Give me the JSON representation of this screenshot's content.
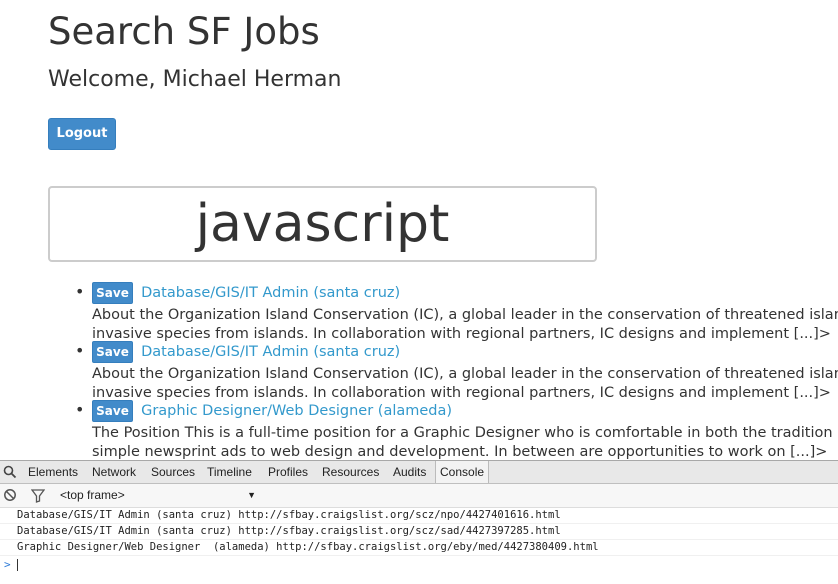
{
  "header": {
    "title": "Search SF Jobs",
    "welcome": "Welcome, Michael Herman",
    "logout_label": "Logout"
  },
  "search": {
    "value": "javascript"
  },
  "jobs": [
    {
      "save_label": "Save",
      "title": "Database/GIS/IT Admin (santa cruz)",
      "line1": "About the Organization Island Conservation (IC), a global leader in the conservation of threatened islan",
      "line2": "invasive species from islands. In collaboration with regional partners, IC designs and implement [...]>"
    },
    {
      "save_label": "Save",
      "title": "Database/GIS/IT Admin (santa cruz)",
      "line1": "About the Organization Island Conservation (IC), a global leader in the conservation of threatened islan",
      "line2": "invasive species from islands. In collaboration with regional partners, IC designs and implement [...]>"
    },
    {
      "save_label": "Save",
      "title": "Graphic Designer/Web Designer (alameda)",
      "line1": "The Position This is a full-time position for a Graphic Designer who is comfortable in both the tradition",
      "line2": "simple newsprint ads to web design and development. In between are opportunities to work on [...]>"
    }
  ],
  "devtools": {
    "tabs": [
      "Elements",
      "Network",
      "Sources",
      "Timeline",
      "Profiles",
      "Resources",
      "Audits",
      "Console"
    ],
    "active_tab": "Console",
    "frame": "<top frame>",
    "console_lines": [
      "Database/GIS/IT Admin (santa cruz) http://sfbay.craigslist.org/scz/npo/4427401616.html",
      "Database/GIS/IT Admin (santa cruz) http://sfbay.craigslist.org/scz/sad/4427397285.html",
      "Graphic Designer/Web Designer  (alameda) http://sfbay.craigslist.org/eby/med/4427380409.html"
    ],
    "prompt": ">",
    "icons": [
      "search-icon",
      "clear-console-icon",
      "filter-icon"
    ]
  }
}
